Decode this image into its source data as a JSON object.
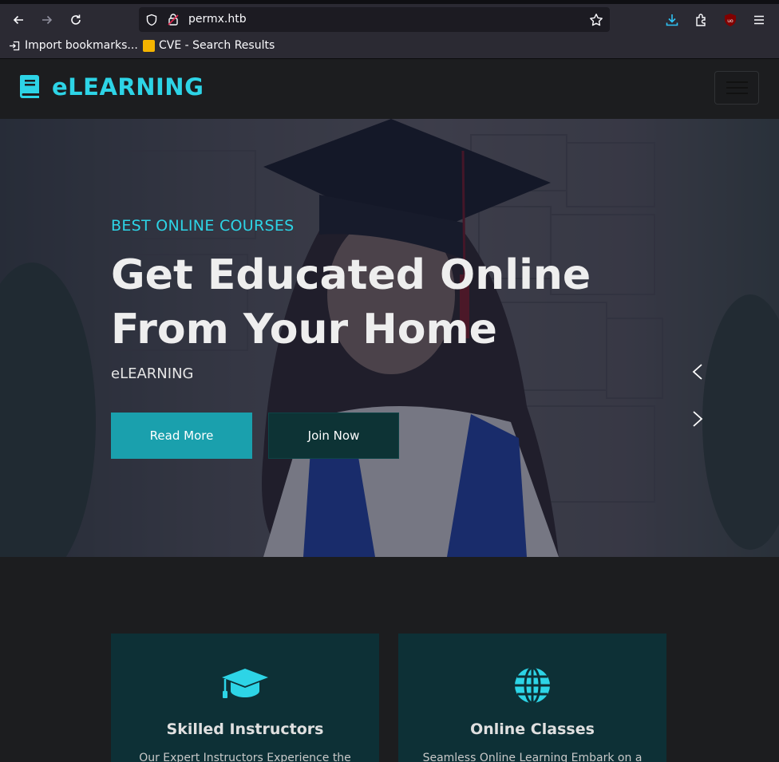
{
  "browser": {
    "url": "permx.htb",
    "bookmarks": [
      {
        "label": "Import bookmarks...",
        "icon": "import-icon"
      },
      {
        "label": "CVE - Search Results",
        "icon": "folder-icon"
      }
    ]
  },
  "navbar": {
    "brand": "eLEARNING",
    "brand_color": "#2dd4e6"
  },
  "hero": {
    "subtitle": "BEST ONLINE COURSES",
    "title_line1": "Get Educated Online",
    "title_line2": "From Your Home",
    "brand": "eLEARNING",
    "read_more": "Read More",
    "join_now": "Join Now"
  },
  "services": [
    {
      "icon": "graduation-cap-icon",
      "title": "Skilled Instructors",
      "text": "Our Expert Instructors Experience the"
    },
    {
      "icon": "globe-icon",
      "title": "Online Classes",
      "text": "Seamless Online Learning Embark on a"
    }
  ]
}
